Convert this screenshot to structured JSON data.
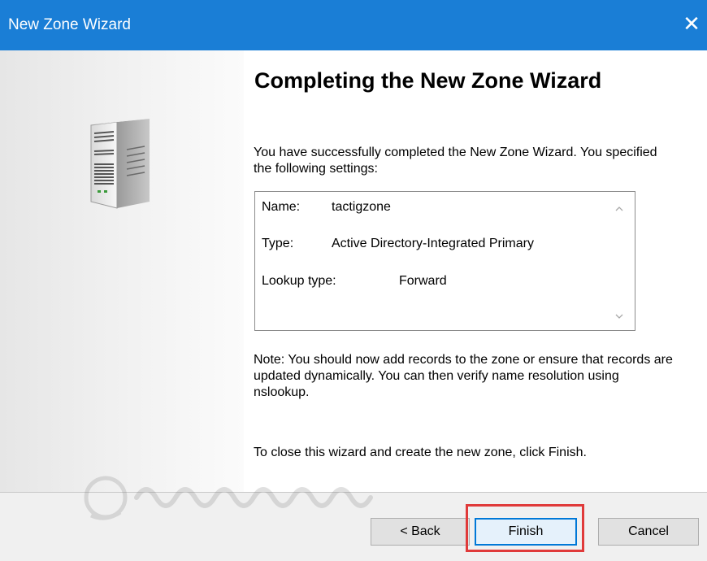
{
  "window": {
    "title": "New Zone Wizard",
    "close_glyph": "✕"
  },
  "content": {
    "heading": "Completing the New Zone Wizard",
    "intro": "You have successfully completed the New Zone Wizard. You specified the following settings:",
    "settings": [
      {
        "label": "Name:",
        "value": "tactigzone"
      },
      {
        "label": "Type:",
        "value": "Active Directory-Integrated Primary"
      },
      {
        "label": "Lookup type:",
        "value": "Forward"
      }
    ],
    "note": "Note: You should now add records to the zone or ensure that records are updated dynamically. You can then verify name resolution using nslookup.",
    "closing": "To close this wizard and create the new zone, click Finish."
  },
  "buttons": {
    "back": "< Back",
    "finish": "Finish",
    "cancel": "Cancel"
  },
  "icons": {
    "server": "server-tower-icon",
    "scroll_up": "scroll-up-arrow-icon",
    "scroll_down": "scroll-down-arrow-icon",
    "close": "close-icon"
  },
  "colors": {
    "titlebar": "#1a7ed6",
    "highlight": "#e03a3a",
    "default_button_border": "#0078d7"
  }
}
